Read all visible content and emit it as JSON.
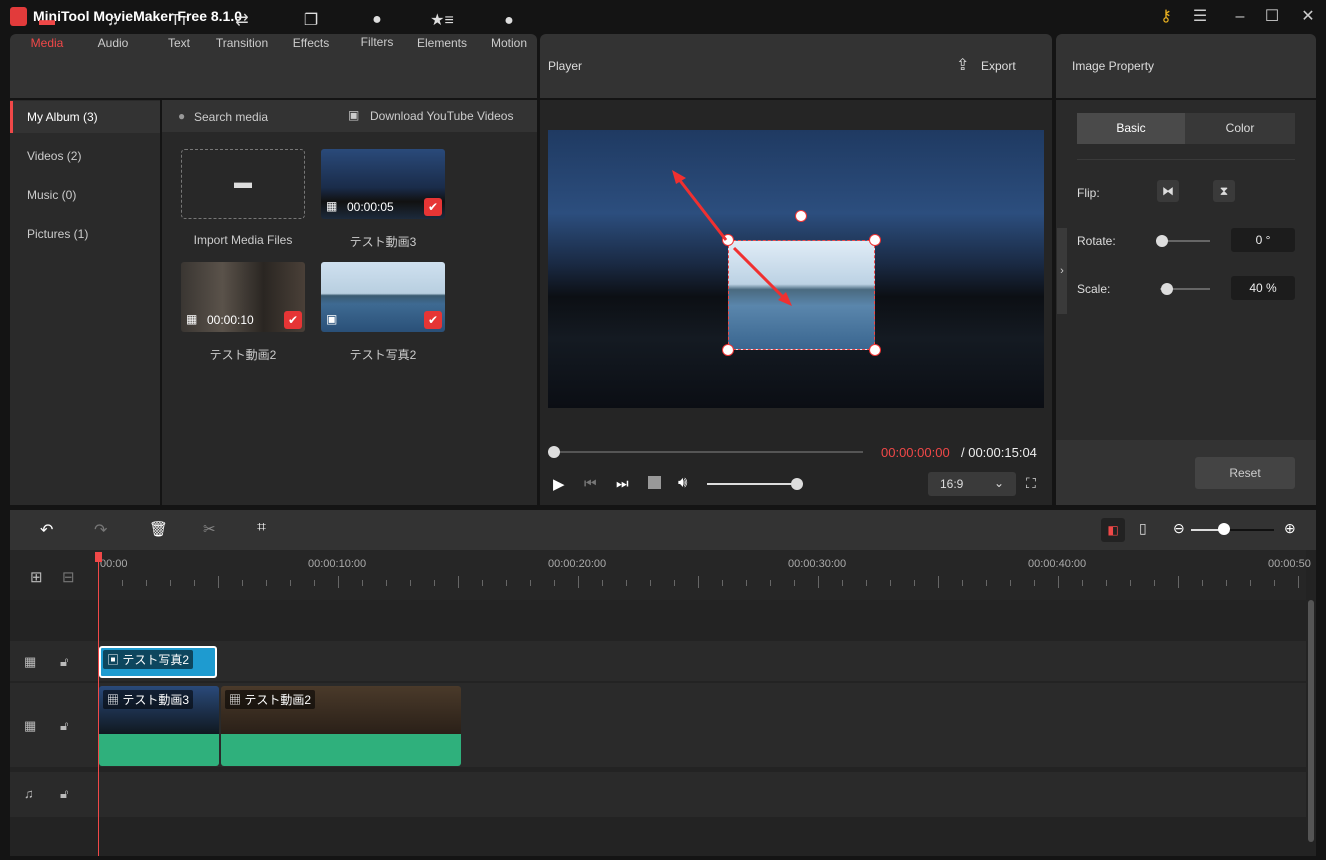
{
  "app": {
    "title": "MiniTool MovieMaker Free 8.1.0",
    "icons": [
      "key-icon",
      "menu-icon",
      "minimize-icon",
      "maximize-icon",
      "close-icon"
    ]
  },
  "tabs": [
    {
      "label": "Media",
      "icon": "folder-icon",
      "active": true
    },
    {
      "label": "Audio",
      "icon": "music-note-icon"
    },
    {
      "label": "Text",
      "icon": "text-icon"
    },
    {
      "label": "Transition",
      "icon": "swap-arrows-icon"
    },
    {
      "label": "Effects",
      "icon": "layers-icon"
    },
    {
      "label": "Filters",
      "icon": "filters-icon"
    },
    {
      "label": "Elements",
      "icon": "star-list-icon"
    },
    {
      "label": "Motion",
      "icon": "motion-icon"
    }
  ],
  "sidebar": {
    "items": [
      {
        "label": "My Album (3)",
        "active": true
      },
      {
        "label": "Videos (2)"
      },
      {
        "label": "Music (0)"
      },
      {
        "label": "Pictures (1)"
      }
    ]
  },
  "media": {
    "search_placeholder": "Search media",
    "download_label": "Download YouTube Videos",
    "import_label": "Import Media Files",
    "items": [
      {
        "name": "テスト動画3",
        "duration": "00:00:05",
        "type": "video"
      },
      {
        "name": "テスト動画2",
        "duration": "00:00:10",
        "type": "video"
      },
      {
        "name": "テスト写真2",
        "type": "image"
      }
    ]
  },
  "player": {
    "title": "Player",
    "export_label": "Export",
    "current_time": "00:00:00:00",
    "total_time": "/ 00:00:15:04",
    "aspect": "16:9",
    "progress": 0,
    "volume": 0.9
  },
  "property": {
    "title": "Image Property",
    "tabs": [
      "Basic",
      "Color"
    ],
    "active_tab": "Basic",
    "flip_label": "Flip:",
    "rotate_label": "Rotate:",
    "rotate_value": "0 °",
    "scale_label": "Scale:",
    "scale_value": "40 %",
    "rotate_fraction": 0,
    "scale_fraction": 0.1,
    "reset_label": "Reset"
  },
  "timeline": {
    "ruler": [
      "00:00",
      "00:00:10:00",
      "00:00:20:00",
      "00:00:30:00",
      "00:00:40:00",
      "00:00:50"
    ],
    "zoom_level": 0.4,
    "clips": {
      "overlay": "テスト写真2",
      "video1": "テスト動画3",
      "video2": "テスト動画2"
    }
  },
  "colors": {
    "accent": "#f04848",
    "clip_blue": "#1e9bd0",
    "audio_green": "#2fb07c"
  }
}
